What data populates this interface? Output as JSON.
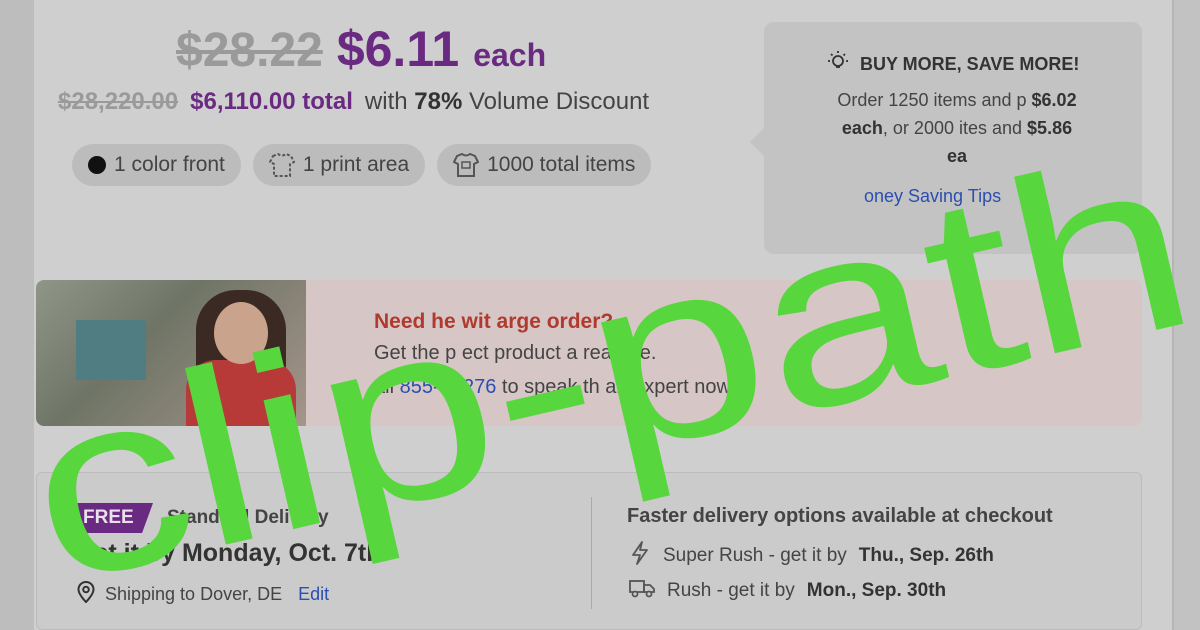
{
  "price": {
    "old_unit": "$28.22",
    "new_unit": "$6.11",
    "unit_suffix": "each",
    "old_total": "$28,220.00",
    "new_total": "$6,110.00 total",
    "discount_prefix": "with",
    "discount_pct": "78%",
    "discount_suffix": "Volume Discount"
  },
  "pills": [
    {
      "label": "1 color front",
      "icon": "color-dot-icon"
    },
    {
      "label": "1 print area",
      "icon": "print-area-icon"
    },
    {
      "label": "1000 total items",
      "icon": "shirt-icon"
    }
  ],
  "buy_more": {
    "title": "BUY MORE, SAVE MORE!",
    "icon": "lightbulb-icon",
    "line1_a": "Order 1250 items and p",
    "line1_price": "$6.02",
    "line2_a": "each",
    "line2_b": ", or 2000 ite",
    "line2_c": "s and",
    "line2_price": "$5.86",
    "line3": "ea",
    "link": "oney Saving Tips"
  },
  "help": {
    "title": "Need he   wit      arge order?",
    "line1": "Get the p     ect product a     reat p   e.",
    "line2_a": "all",
    "phone": "855-   -2276",
    "line2_b": "to speak   th an expert now!"
  },
  "delivery": {
    "free_badge": "FREE",
    "standard_label": "Standard Delivery",
    "get_it": "Get it by Monday, Oct. 7th",
    "ship_to": "Shipping to Dover, DE",
    "edit": "Edit",
    "faster_title": "Faster delivery options available at checkout",
    "super_rush_a": "Super Rush - get it by",
    "super_rush_date": "Thu., Sep. 26th",
    "rush_a": "Rush - get it by",
    "rush_date": "Mon., Sep. 30th"
  },
  "overlay": {
    "text": "clip-path",
    "color": "#58d63d"
  },
  "colors": {
    "brand_purple": "#6b2a82",
    "link_blue": "#2b4fb0",
    "help_red": "#b03a2e"
  }
}
